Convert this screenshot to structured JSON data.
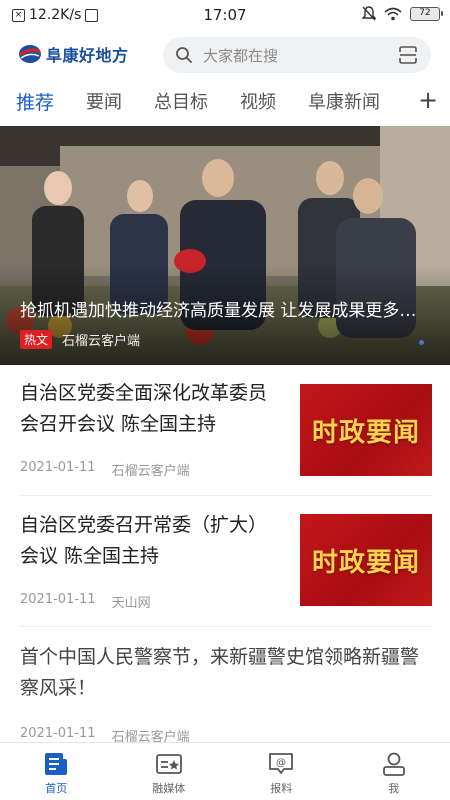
{
  "status_bar": {
    "speed": "12.2K/s",
    "time": "17:07",
    "battery": "72"
  },
  "header": {
    "logo_text": "阜康好地方",
    "search_placeholder": "大家都在搜"
  },
  "tabs": [
    {
      "label": "推荐",
      "active": true
    },
    {
      "label": "要闻",
      "active": false
    },
    {
      "label": "总目标",
      "active": false
    },
    {
      "label": "视频",
      "active": false
    },
    {
      "label": "阜康新闻",
      "active": false
    }
  ],
  "hero": {
    "title": "抢抓机遇加快推动经济高质量发展 让发展成果更多更公平惠及各族群众",
    "badge": "热文",
    "source": "石榴云客户端"
  },
  "news": [
    {
      "title": "自治区党委全面深化改革委员会召开会议 陈全国主持",
      "date": "2021-01-11",
      "source": "石榴云客户端",
      "thumb_text": "时政要闻"
    },
    {
      "title": "自治区党委召开常委（扩大）会议 陈全国主持",
      "date": "2021-01-11",
      "source": "天山网",
      "thumb_text": "时政要闻"
    },
    {
      "title": "首个中国人民警察节，来新疆警史馆领略新疆警察风采！",
      "date": "2021-01-11",
      "source": "石榴云客户端"
    }
  ],
  "bottom_nav": [
    {
      "label": "首页",
      "icon": "home-news-icon",
      "active": true
    },
    {
      "label": "融媒体",
      "icon": "media-card-icon",
      "active": false
    },
    {
      "label": "报料",
      "icon": "report-chat-icon",
      "active": false
    },
    {
      "label": "我",
      "icon": "profile-icon",
      "active": false
    }
  ],
  "colors": {
    "accent": "#1a5fc4",
    "badge_red": "#e02020",
    "thumb_red": "#c3161b",
    "thumb_gold": "#ffd34d"
  }
}
